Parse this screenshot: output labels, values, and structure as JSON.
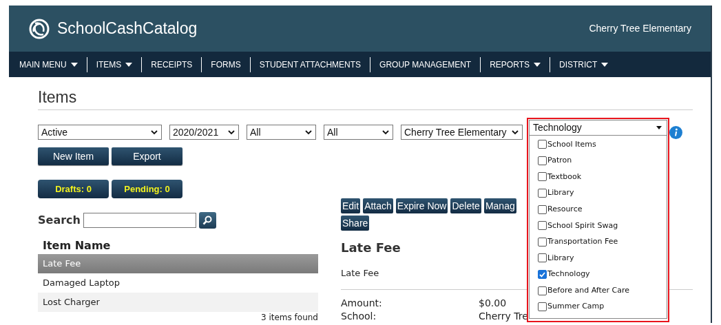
{
  "header": {
    "logo_text": "SchoolCashCatalog",
    "school": "Cherry Tree Elementary"
  },
  "nav": [
    {
      "label": "MAIN MENU",
      "caret": true
    },
    {
      "label": "ITEMS",
      "caret": true
    },
    {
      "label": "RECEIPTS",
      "caret": false
    },
    {
      "label": "FORMS",
      "caret": false
    },
    {
      "label": "STUDENT ATTACHMENTS",
      "caret": false
    },
    {
      "label": "GROUP MANAGEMENT",
      "caret": false
    },
    {
      "label": "REPORTS",
      "caret": true
    },
    {
      "label": "DISTRICT",
      "caret": true
    }
  ],
  "page_title": "Items",
  "filters": [
    {
      "value": "Active"
    },
    {
      "value": "2020/2021"
    },
    {
      "value": "All"
    },
    {
      "value": "All"
    },
    {
      "value": "Cherry Tree Elementary"
    }
  ],
  "category_dropdown": {
    "value": "Technology",
    "options": [
      {
        "label": "School Items",
        "checked": false
      },
      {
        "label": "Patron",
        "checked": false
      },
      {
        "label": "Textbook",
        "checked": false
      },
      {
        "label": "Library",
        "checked": false
      },
      {
        "label": "Resource",
        "checked": false
      },
      {
        "label": "School Spirit Swag",
        "checked": false
      },
      {
        "label": "Transportation Fee",
        "checked": false
      },
      {
        "label": "Library",
        "checked": false
      },
      {
        "label": "Technology",
        "checked": true
      },
      {
        "label": "Before and After Care",
        "checked": false
      },
      {
        "label": "Summer Camp",
        "checked": false
      }
    ]
  },
  "buttons": [
    "New Item",
    "Export"
  ],
  "badges": [
    "Drafts: 0",
    "Pending: 0"
  ],
  "search": {
    "label": "Search"
  },
  "table": {
    "column": "Item Name",
    "rows": [
      {
        "name": "Late Fee",
        "selected": true
      },
      {
        "name": "Damaged Laptop",
        "selected": false
      },
      {
        "name": "Lost Charger",
        "selected": false
      }
    ],
    "footer": "3 items found"
  },
  "detail": {
    "actions": [
      "Edit",
      "Attach",
      "Expire Now",
      "Delete",
      "Manag",
      "Share"
    ],
    "title": "Late Fee",
    "subtitle": "Late Fee",
    "fields": [
      {
        "label": "Amount:",
        "value": "$0.00"
      },
      {
        "label": "School:",
        "value": "Cherry Tre"
      }
    ]
  }
}
